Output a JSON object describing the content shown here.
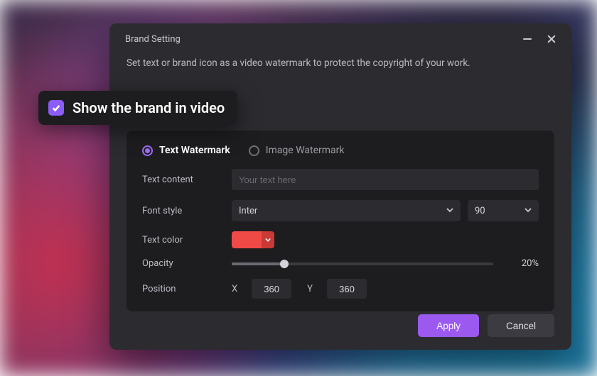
{
  "dialog": {
    "title": "Brand Setting",
    "description": "Set  text or brand icon as a video watermark to protect the copyright of your work."
  },
  "callout": {
    "checked": true,
    "label": "Show the brand in video"
  },
  "tabs": {
    "text": "Text Watermark",
    "image": "Image Watermark",
    "active": "text"
  },
  "form": {
    "text_content": {
      "label": "Text content",
      "placeholder": "Your text here",
      "value": ""
    },
    "font_style": {
      "label": "Font style",
      "font": "Inter",
      "size": "90"
    },
    "text_color": {
      "label": "Text color",
      "value": "#f04a46"
    },
    "opacity": {
      "label": "Opacity",
      "value": 20,
      "display": "20%"
    },
    "position": {
      "label": "Position",
      "x_label": "X",
      "x": "360",
      "y_label": "Y",
      "y": "360"
    }
  },
  "footer": {
    "apply": "Apply",
    "cancel": "Cancel"
  }
}
